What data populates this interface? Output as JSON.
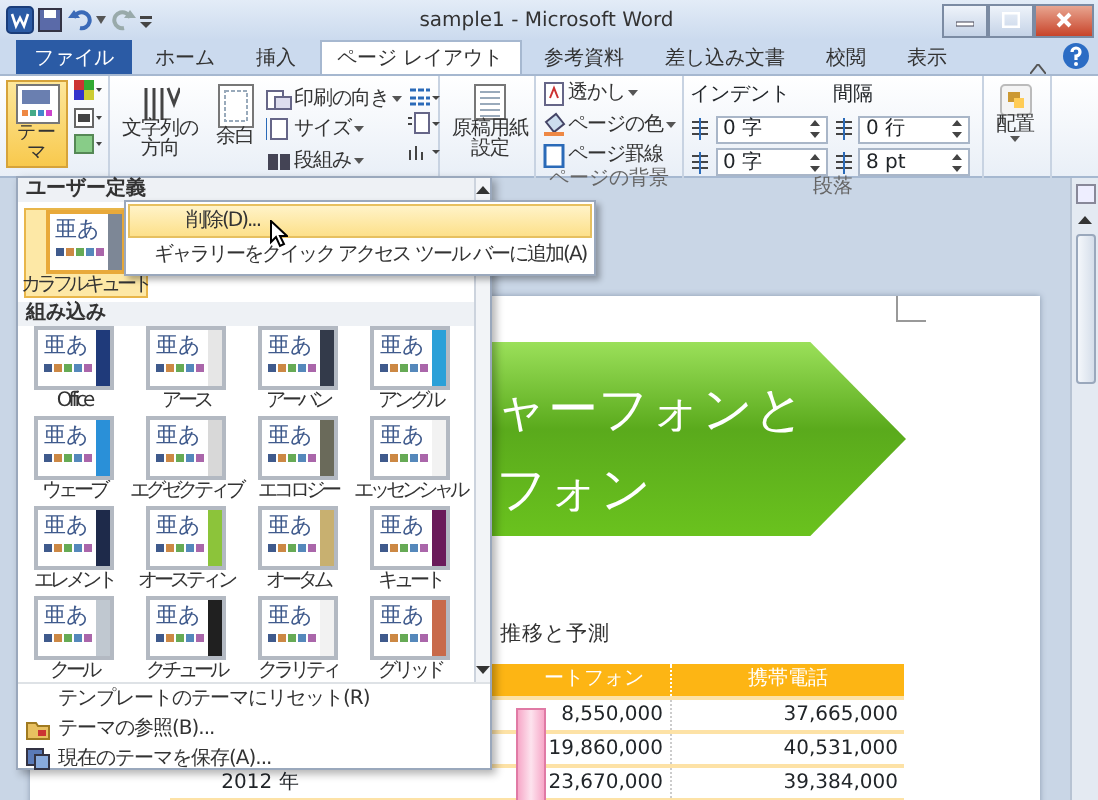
{
  "window": {
    "title": "sample1 - Microsoft Word"
  },
  "tabs": [
    {
      "label": "ファイル",
      "kind": "file",
      "selected": false
    },
    {
      "label": "ホーム",
      "kind": "tab",
      "selected": false
    },
    {
      "label": "挿入",
      "kind": "tab",
      "selected": false
    },
    {
      "label": "ページ レイアウト",
      "kind": "tab",
      "selected": true
    },
    {
      "label": "参考資料",
      "kind": "tab",
      "selected": false
    },
    {
      "label": "差し込み文書",
      "kind": "tab",
      "selected": false
    },
    {
      "label": "校閲",
      "kind": "tab",
      "selected": false
    },
    {
      "label": "表示",
      "kind": "tab",
      "selected": false
    }
  ],
  "ribbon": {
    "themes": {
      "button": "テーマ"
    },
    "page_setup": {
      "text_direction": [
        "文字列の",
        "方向"
      ],
      "margins": "余白",
      "orientation": "印刷の向き",
      "size": "サイズ",
      "columns": "段組み"
    },
    "manuscript": {
      "button": [
        "原稿用紙",
        "設定"
      ]
    },
    "page_background": {
      "label": "ページの背景",
      "watermark": "透かし",
      "page_color": "ページの色",
      "page_borders": "ページ罫線"
    },
    "paragraph": {
      "label": "段落",
      "indent_label": "インデント",
      "indent_left": "0 字",
      "indent_right": "0 字",
      "spacing_label": "間隔",
      "spacing_before": "0 行",
      "spacing_after": "8 pt"
    },
    "arrange": {
      "button": "配置"
    }
  },
  "document": {
    "banner": [
      "ャーフォンと",
      "フォン"
    ],
    "heading": "推移と予測",
    "table": {
      "header": {
        "column_2": "ートフォン",
        "column_3": "携帯電話"
      },
      "rows": [
        {
          "column_2": "8,550,000",
          "column_3": "37,665,000"
        },
        {
          "column_2": "19,860,000",
          "column_3": "40,531,000"
        },
        {
          "column_1": "2012 年",
          "column_2": "23,670,000",
          "column_3": "39,384,000"
        }
      ]
    }
  },
  "theme_menu": {
    "custom_heading": "ユーザー定義",
    "custom": [
      {
        "name": "カラフルキュート",
        "sample": "亜あ",
        "color": "#7d8796",
        "selected": true
      }
    ],
    "builtin_heading": "組み込み",
    "builtin": [
      {
        "name": "Office",
        "sample": "亜あ",
        "color": "#1f3a7a",
        "selected": false
      },
      {
        "name": "アース",
        "sample": "亜あ",
        "color": "#e6e6e6",
        "selected": false
      },
      {
        "name": "アーバン",
        "sample": "亜あ",
        "color": "#333a4a",
        "selected": false
      },
      {
        "name": "アングル",
        "sample": "亜あ",
        "color": "#2aa0d8",
        "selected": false
      },
      {
        "name": "ウェーブ",
        "sample": "亜あ",
        "color": "#2a90d8",
        "selected": false
      },
      {
        "name": "エグゼクティブ",
        "sample": "亜あ",
        "color": "#d8d8d8",
        "selected": false
      },
      {
        "name": "エコロジー",
        "sample": "亜あ",
        "color": "#6a6a5a",
        "selected": false
      },
      {
        "name": "エッセンシャル",
        "sample": "亜あ",
        "color": "#f2f2f2",
        "selected": false
      },
      {
        "name": "エレメント",
        "sample": "亜あ",
        "color": "#1e2a4a",
        "selected": false
      },
      {
        "name": "オースティン",
        "sample": "亜あ",
        "color": "#8cc43a",
        "selected": false
      },
      {
        "name": "オータム",
        "sample": "亜あ",
        "color": "#c8b070",
        "selected": false
      },
      {
        "name": "キュート",
        "sample": "亜あ",
        "color": "#6a1a5a",
        "selected": false
      },
      {
        "name": "クール",
        "sample": "亜あ",
        "color": "#c0c8d0",
        "selected": false
      },
      {
        "name": "クチュール",
        "sample": "亜あ",
        "color": "#202020",
        "selected": false
      },
      {
        "name": "クラリティ",
        "sample": "亜あ",
        "color": "#f2f2f2",
        "selected": false
      },
      {
        "name": "グリッド",
        "sample": "亜あ",
        "color": "#c86a4a",
        "selected": false
      }
    ],
    "footer": [
      {
        "label": "テンプレートのテーマにリセット(R)",
        "kind": "plain"
      },
      {
        "label": "テーマの参照(B)...",
        "kind": "browse"
      },
      {
        "label": "現在のテーマを保存(A)...",
        "kind": "save"
      }
    ]
  },
  "context_menu": [
    {
      "label": "削除(D)...",
      "selected": true
    },
    {
      "label": "ギャラリーをクイック アクセス ツール バーに追加(A)",
      "selected": false
    }
  ]
}
